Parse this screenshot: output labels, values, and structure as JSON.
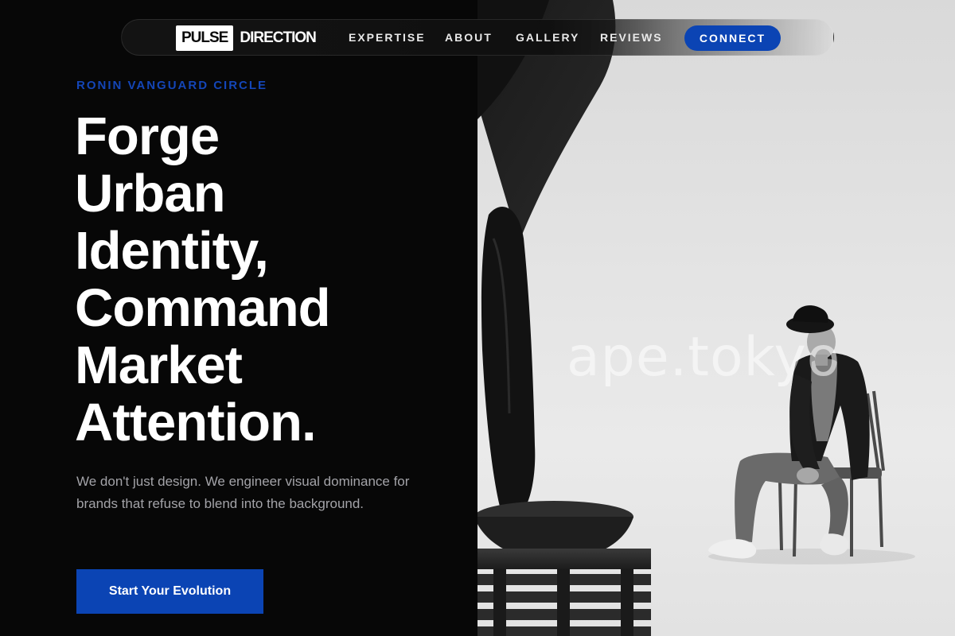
{
  "nav": {
    "logo_box": "PULSE",
    "logo_word": "DIRECTION",
    "links": [
      "EXPERTISE",
      "ABOUT",
      "GALLERY",
      "REVIEWS"
    ],
    "cta": "CONNECT"
  },
  "hero": {
    "eyebrow": "RONIN VANGUARD CIRCLE",
    "headline_lines": [
      "Forge",
      "Urban",
      "Identity,",
      "Command",
      "Market",
      "Attention."
    ],
    "subtext": "We don't just design. We engineer visual dominance for brands that refuse to blend into the background.",
    "cta": "Start Your Evolution"
  },
  "photo": {
    "watermark": "ape.tokyo"
  },
  "colors": {
    "background": "#070707",
    "accent": "#0b44b4",
    "eyebrow": "#1446b8",
    "subtext": "#a3a3a8"
  }
}
